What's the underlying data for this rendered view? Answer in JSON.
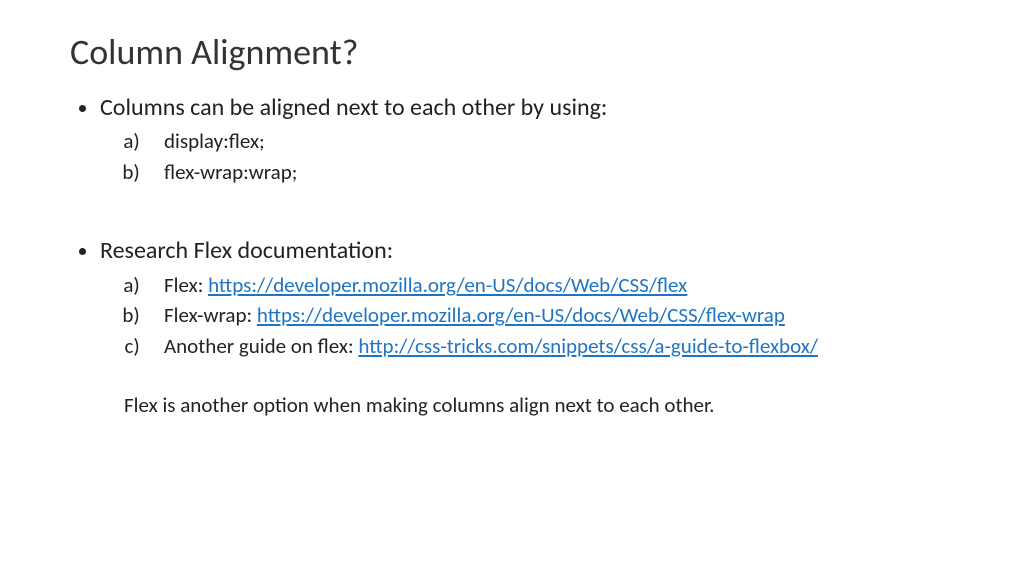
{
  "title": "Column Alignment?",
  "bullet1": {
    "text": "Columns can be aligned next to each other by using:",
    "subs": {
      "a": "display:flex;",
      "b": "flex-wrap:wrap;"
    }
  },
  "bullet2": {
    "text": "Research Flex documentation:",
    "subs": {
      "a_label": "Flex: ",
      "a_link": "https://developer.mozilla.org/en-US/docs/Web/CSS/flex",
      "b_label": "Flex-wrap: ",
      "b_link": "https://developer.mozilla.org/en-US/docs/Web/CSS/flex-wrap",
      "c_label": "Another guide on flex: ",
      "c_link": "http://css-tricks.com/snippets/css/a-guide-to-flexbox/"
    }
  },
  "footnote": "Flex is another option when making columns align next to each other."
}
